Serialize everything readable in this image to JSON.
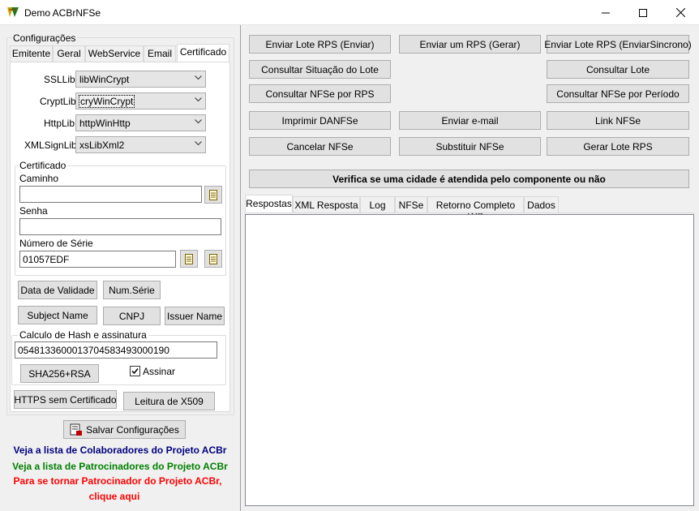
{
  "window": {
    "title": "Demo ACBrNFSe"
  },
  "config": {
    "group_label": "Configurações",
    "tabs": [
      "Emitente",
      "Geral",
      "WebService",
      "Email",
      "Certificado"
    ],
    "active_tab": "Certificado",
    "ssllib": {
      "label": "SSLLib",
      "value": "libWinCrypt"
    },
    "cryptlib": {
      "label": "CryptLib",
      "value": "cryWinCrypt"
    },
    "httplib": {
      "label": "HttpLib",
      "value": "httpWinHttp"
    },
    "xmlsignlib": {
      "label": "XMLSignLib",
      "value": "xsLibXml2"
    },
    "certificado": {
      "group_label": "Certificado",
      "caminho_label": "Caminho",
      "caminho_value": "",
      "senha_label": "Senha",
      "senha_value": "",
      "numserie_label": "Número de Série",
      "numserie_value": "01057EDF"
    },
    "buttons": {
      "data_validade": "Data de Validade",
      "num_serie": "Num.Série",
      "subject_name": "Subject Name",
      "cnpj": "CNPJ",
      "issuer_name": "Issuer Name",
      "https_sem_cert": "HTTPS sem Certificado",
      "leitura_x509": "Leitura de X509"
    },
    "hash": {
      "group_label": "Calculo de Hash e assinatura",
      "value": "05481336000137045834930001​90",
      "sha_button": "SHA256+RSA",
      "assinar_label": "Assinar",
      "assinar_checked": true
    },
    "save_button": "Salvar Configurações"
  },
  "links": {
    "colaboradores": "Veja a lista de Colaboradores do Projeto ACBr",
    "patrocinadores": "Veja a lista de Patrocinadores do Projeto ACBr",
    "tornar_line1": "Para se tornar Patrocinador do Projeto ACBr,",
    "tornar_line2": "clique aqui"
  },
  "actions": {
    "enviar_lote": "Enviar Lote RPS (Enviar)",
    "enviar_um": "Enviar um RPS (Gerar)",
    "enviar_sincrono": "Enviar Lote RPS (EnviarSincrono)",
    "consultar_situacao": "Consultar Situação do Lote",
    "consultar_lote": "Consultar Lote",
    "consultar_nfse_rps": "Consultar NFSe por RPS",
    "consultar_periodo": "Consultar NFSe por Período",
    "imprimir_danfse": "Imprimir DANFSe",
    "enviar_email": "Enviar e-mail",
    "link_nfse": "Link NFSe",
    "cancelar_nfse": "Cancelar NFSe",
    "substituir_nfse": "Substituir NFSe",
    "gerar_lote": "Gerar Lote RPS",
    "verifica_cidade": "Verifica se uma cidade é atendida pelo componente ou não"
  },
  "result_tabs": [
    "Respostas",
    "XML Resposta",
    "Log",
    "NFSe",
    "Retorno Completo WS",
    "Dados"
  ],
  "active_result_tab": "Respostas"
}
